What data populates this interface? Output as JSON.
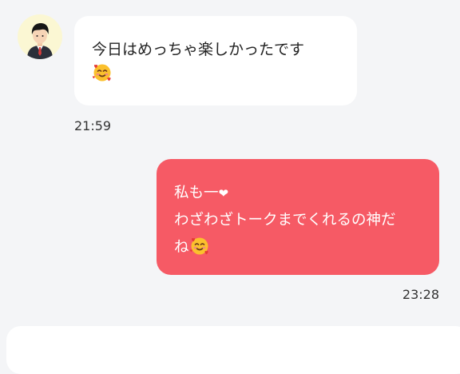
{
  "chat": {
    "incoming": {
      "text": "今日はめっちゃ楽しかったです",
      "emoji": "smiling-face-with-hearts",
      "time": "21:59"
    },
    "outgoing": {
      "line1": "私も一",
      "heart": "❤",
      "line2": "わざわざトークまでくれるの神だ",
      "line3": "ね",
      "emoji": "smiling-face-with-hearts",
      "time": "23:28"
    }
  },
  "colors": {
    "background": "#f4f5f7",
    "incoming_bubble": "#ffffff",
    "outgoing_bubble": "#f65a65",
    "avatar_bg": "#fbf7d3"
  }
}
